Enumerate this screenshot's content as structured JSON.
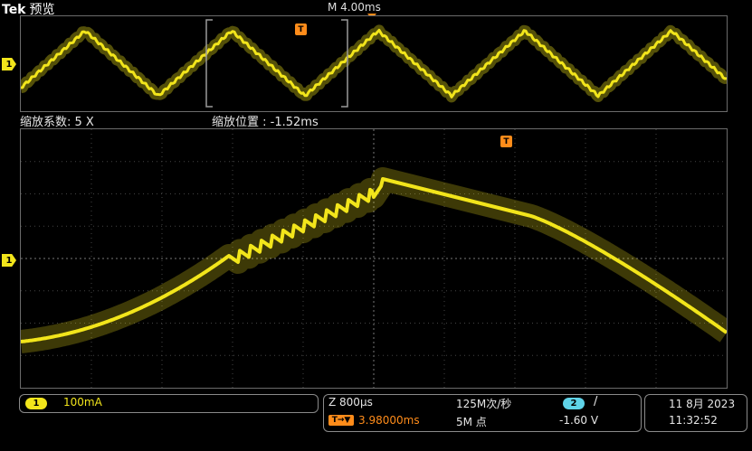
{
  "header": {
    "brand": "Tek",
    "mode": "预览",
    "main_timebase": "M 4.00ms"
  },
  "overview": {
    "channel_marker": "1",
    "trigger_marker": "T"
  },
  "zoom": {
    "factor_label": "缩放系数: 5 X",
    "position_label": "缩放位置 :  -1.52ms",
    "channel_marker": "1",
    "trigger_marker": "T"
  },
  "status": {
    "ch1_badge": "1",
    "ch1_scale": "100mA",
    "zoom_scale": "Z 800µs",
    "sample_rate": "125M次/秒",
    "trigger_source_badge": "2",
    "trigger_slope": "/",
    "trigger_pos_icon": "T→▼",
    "trigger_position": "3.98000ms",
    "record_length": "5M 点",
    "trigger_level": "-1.60 V",
    "date": "11 8月 2023",
    "time": "11:32:52"
  },
  "colors": {
    "ch1": "#f2e51b",
    "ch2": "#5fd3e8",
    "trigger": "#ff8c1a"
  }
}
